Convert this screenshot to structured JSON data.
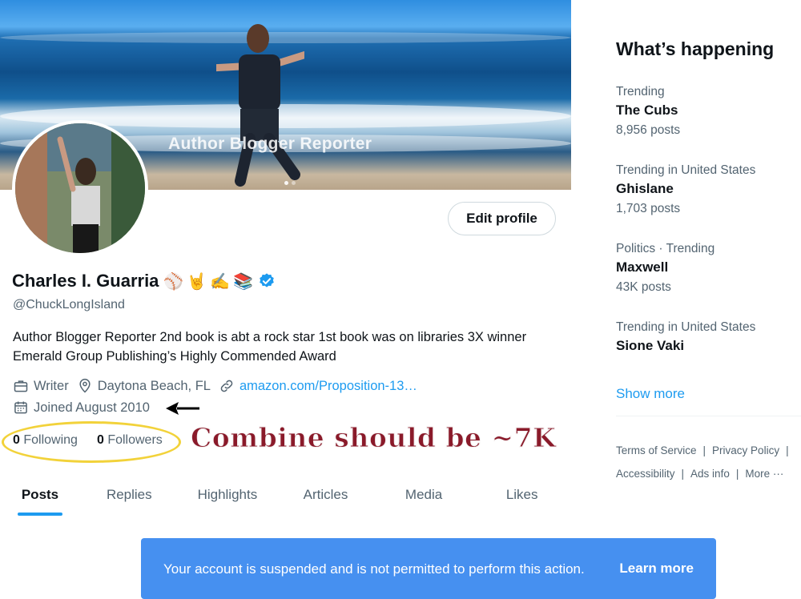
{
  "banner": {
    "overlay_text": "Author Blogger Reporter"
  },
  "profile": {
    "edit_button": "Edit profile",
    "name": "Charles I. Guarria",
    "emojis": [
      "⚾",
      "🤘",
      "✍️",
      "📚"
    ],
    "handle": "@ChuckLongIsland",
    "bio": "Author Blogger Reporter 2nd book is abt a rock star 1st book was on libraries 3X winner Emerald Group Publishing’s Highly Commended Award",
    "occupation": "Writer",
    "location": "Daytona Beach, FL",
    "website": "amazon.com/Proposition-13…",
    "joined": "Joined August 2010",
    "following_count": "0",
    "following_label": "Following",
    "followers_count": "0",
    "followers_label": "Followers"
  },
  "annotation": "Combine should be ~7K",
  "tabs": [
    {
      "label": "Posts",
      "active": true
    },
    {
      "label": "Replies"
    },
    {
      "label": "Highlights"
    },
    {
      "label": "Articles"
    },
    {
      "label": "Media"
    },
    {
      "label": "Likes"
    }
  ],
  "suspension": {
    "message": "Your account is suspended and is not permitted to perform this action.",
    "link": "Learn more"
  },
  "sidebar": {
    "title": "What’s happening",
    "trends": [
      {
        "context": "Trending",
        "topic": "The Cubs",
        "count": "8,956 posts"
      },
      {
        "context": "Trending in United States",
        "topic": "Ghislane",
        "count": "1,703 posts"
      },
      {
        "context": "Politics · Trending",
        "topic": "Maxwell",
        "count": "43K posts"
      },
      {
        "context": "Trending in United States",
        "topic": "Sione Vaki",
        "count": ""
      }
    ],
    "show_more": "Show more",
    "footer": {
      "terms": "Terms of Service",
      "privacy": "Privacy Policy",
      "accessibility": "Accessibility",
      "ads": "Ads info",
      "more": "More ···"
    }
  },
  "colors": {
    "accent": "#1d9bf0",
    "suspension_bg": "#4690f0",
    "highlight_circle": "#f2d23a",
    "annotation_text": "#8a1a2a"
  }
}
